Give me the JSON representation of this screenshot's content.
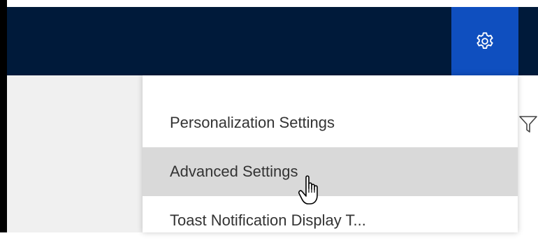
{
  "header": {
    "settings_icon": "gear-icon",
    "bg_color": "#001a3a",
    "accent_color": "#0f4fbf"
  },
  "settings_menu": {
    "items": [
      {
        "label": "Personalization Settings",
        "hovered": false
      },
      {
        "label": "Advanced Settings",
        "hovered": true
      },
      {
        "label": "Toast Notification Display T...",
        "hovered": false
      }
    ],
    "hover_color": "#d9d9d9"
  },
  "toolbar": {
    "filter_icon": "filter-icon"
  },
  "pointer": {
    "icon": "hand-pointer-icon"
  }
}
